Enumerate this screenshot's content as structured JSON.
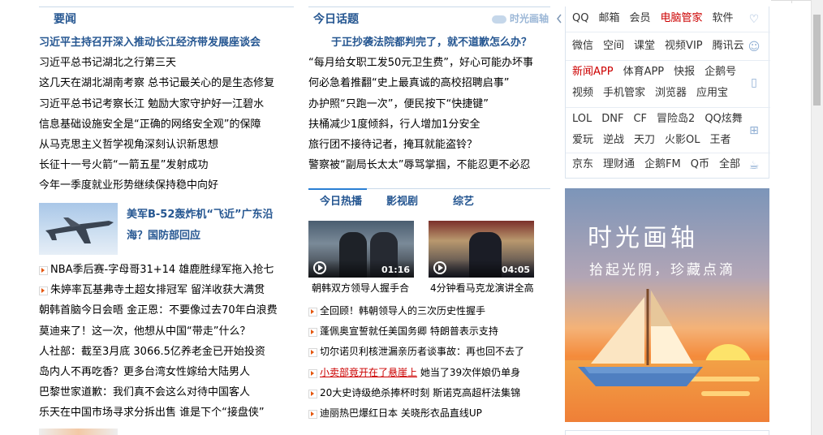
{
  "left": {
    "section_title": "要闻",
    "news": [
      "习近平主持召开深入推动长江经济带发展座谈会",
      "习近平总书记湖北之行第三天",
      "这几天在湖北湖南考察 总书记最关心的是生态修复",
      "习近平总书记考察长江 勉励大家守护好一江碧水",
      "信息基础设施安全是“正确的网络安全观”的保障",
      "从马克思主义哲学视角深刻认识新思想",
      "长征十一号火箭“一箭五星”发射成功",
      "今年一季度就业形势继续保持稳中向好"
    ],
    "feature_text": "美军B-52轰炸机“飞近”广东沿海？国防部回应",
    "news2": [
      "NBA季后赛-字母哥31+14 雄鹿胜绿军拖入抢七",
      "朱婷率瓦基弗寺土超女排冠军 留洋收获大满贯",
      "朝韩首脑今日会晤 金正恩：不要像过去70年白浪费",
      "莫迪来了！这一次，他想从中国“带走”什么？",
      "人社部：截至3月底 3066.5亿养老金已开始投资",
      "岛内人不再吃香？更多台湾女性嫁给大陆男人",
      "巴黎世家道歉：我们真不会这么对待中国客人",
      "乐天在中国市场寻求分拆出售 谁是下个“接盘侠”"
    ]
  },
  "mid": {
    "section_title": "今日话题",
    "brand": "时光画轴",
    "news": [
      "于正抄袭法院都判完了，就不道歉怎么办？",
      "“每月给女职工发50元卫生费”，好心可能办坏事",
      "何必急着推翻“史上最真诚的高校招聘启事”",
      "办护照“只跑一次”，便民按下“快捷键”",
      "扶桶减少1度倾斜，行人增加1分安全",
      "旅行团不接待记者，掩耳就能盗铃？",
      "警察被“副局长太太”辱骂掌掴，不能忍更不必忍"
    ],
    "tabs": [
      "今日热播",
      "影视剧",
      "综艺"
    ],
    "videos": [
      {
        "duration": "01:16",
        "caption": "朝韩双方领导人握手合"
      },
      {
        "duration": "04:05",
        "caption": "4分钟看马克龙演讲全高"
      }
    ],
    "news2_prefix": [
      "全回顾！韩朝领导人的三次历史性握手",
      "蓬佩奥宣誓就任美国务卿 特朗普表示支持",
      "切尔诺贝利核泄漏亲历者谈事故：再也回不去了"
    ],
    "news2_highlight": "小卖部竟开在了悬崖上",
    "news2_highlight_rest": " 她当了39次伴娘仍单身",
    "news2_suffix": [
      "20大史诗级绝杀捧杯时刻 斯诺克高超杆法集锦",
      "迪丽热巴爆红日本 关晓彤衣品直线UP"
    ]
  },
  "right": {
    "rows": [
      [
        "QQ",
        "邮箱",
        "会员",
        "电脑管家",
        "软件"
      ],
      [
        "微信",
        "空间",
        "课堂",
        "视频VIP",
        "腾讯云"
      ],
      [
        "新闻APP",
        "体育APP",
        "快报",
        "企鹅号"
      ],
      [
        "视频",
        "手机管家",
        "浏览器",
        "应用宝"
      ],
      [
        "LOL",
        "DNF",
        "CF",
        "冒险岛2",
        "QQ炫舞"
      ],
      [
        "爱玩",
        "逆战",
        "天刀",
        "火影OL",
        "王者"
      ],
      [
        "京东",
        "理财通",
        "企鹅FM",
        "Q币",
        "全部"
      ]
    ],
    "red_items": [
      "电脑管家",
      "新闻APP"
    ],
    "banner_title": "时光画轴",
    "banner_sub": "拾起光阴，珍藏点滴"
  },
  "colors": {
    "heading_blue": "#255691",
    "highlight_red": "#cc0000",
    "accent_orange": "#e5570f"
  }
}
